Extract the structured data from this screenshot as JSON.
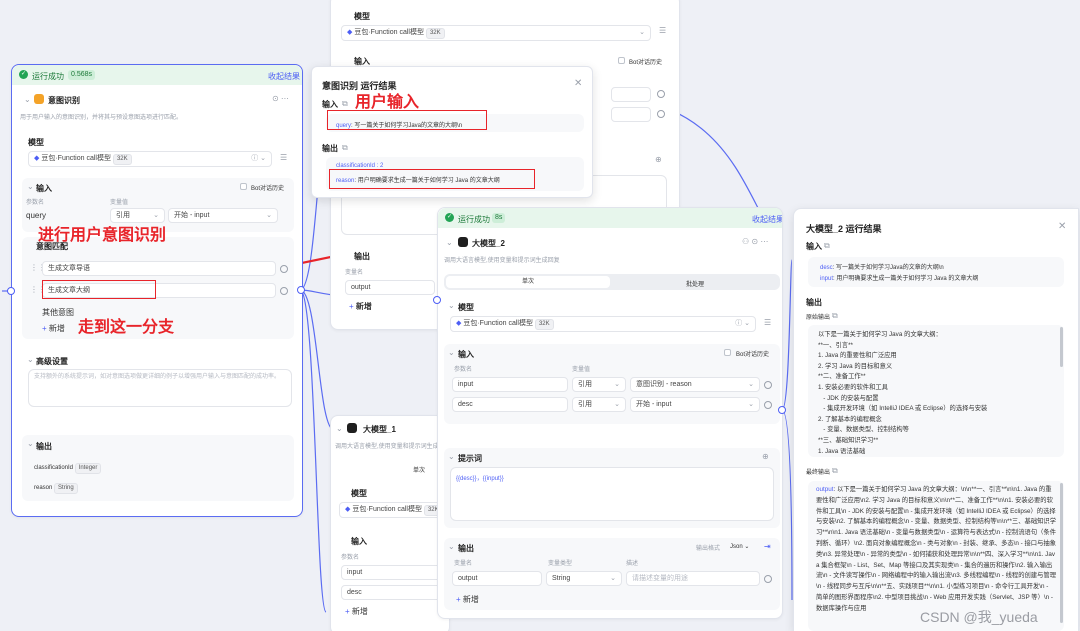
{
  "intent_node": {
    "status": "运行成功",
    "time": "0.568s",
    "collapse": "收起结果",
    "title": "意图识别",
    "desc": "用于用户输入的意图识别，并将其与预设意图选项进行匹配。",
    "model_label": "模型",
    "model_name": "豆包·Function call模型",
    "model_tag": "32K",
    "input_label": "输入",
    "bot_history": "Bot对话历史",
    "col_param": "参数名",
    "col_value": "变量值",
    "param_name": "query",
    "ref": "引用",
    "ref_value": "开始 - input",
    "intent_match": "意图匹配",
    "intent1": "生成文章导语",
    "intent2": "生成文章大纲",
    "other": "其他意图",
    "add": "新增",
    "advanced": "高级设置",
    "advanced_placeholder": "支持额外的系统提示词，如对意图选项做更详细的例子以增强用户输入与意图匹配的成功率。",
    "output_label": "输出",
    "out1_name": "classificationId",
    "out1_type": "Integer",
    "out2_name": "reason",
    "out2_type": "String"
  },
  "popup": {
    "title": "意图识别 运行结果",
    "input_label": "输入",
    "input_key": "query",
    "input_value": ": 写一篇关于如何学习Java的文章的大纲\\n",
    "output_label": "输出",
    "class_line": "classificationId : 2",
    "reason_key": "reason",
    "reason_value": ": 用户明确要求生成一篇关于如何学习 Java 的文章大纲"
  },
  "top_node": {
    "model_label": "模型",
    "model_name": "豆包·Function call模型",
    "model_tag": "32K",
    "input_label": "输入",
    "bot_history": "Bot对话历史",
    "output_label": "输出",
    "col_var": "变量名",
    "output_var": "output",
    "add": "新增"
  },
  "llm2": {
    "status": "运行成功",
    "time": "8s",
    "collapse": "收起结果",
    "title": "大模型_2",
    "desc": "调用大语言模型,使用变量和提示词生成回复",
    "tab_single": "单次",
    "tab_batch": "批处理",
    "model_label": "模型",
    "model_name": "豆包·Function call模型",
    "model_tag": "32K",
    "input_label": "输入",
    "bot_history": "Bot对话历史",
    "col_param": "参数名",
    "col_value": "变量值",
    "row1_name": "input",
    "row1_ref": "引用",
    "row1_value": "意图识别 - reason",
    "row2_name": "desc",
    "row2_ref": "引用",
    "row2_value": "开始 - input",
    "prompt_label": "提示词",
    "prompt_text": "{{desc}}，{{input}}",
    "output_label": "输出",
    "output_format_label": "输出格式",
    "output_format": "Json",
    "col_var": "变量名",
    "col_type": "变量类型",
    "col_desc": "描述",
    "output_var": "output",
    "output_type": "String",
    "output_desc_placeholder": "请描述变量的用途",
    "add": "新增"
  },
  "llm1": {
    "title": "大模型_1",
    "desc": "调用大语言模型,使用变量和提示词生成回复",
    "tab_single": "单次",
    "model_label": "模型",
    "model_name": "豆包·Function call模型",
    "model_tag": "32K",
    "input_label": "输入",
    "col_param": "参数名",
    "row1_name": "input",
    "row2_name": "desc",
    "add": "新增"
  },
  "result": {
    "title": "大模型_2 运行结果",
    "input_label": "输入",
    "in1_key": "desc",
    "in1_value": ": 写一篇关于如何学习Java的文章的大纲\\n",
    "in2_key": "input",
    "in2_value": ": 用户明确要求生成一篇关于如何学习 Java 的文章大纲",
    "output_label": "输出",
    "raw_label": "原始输出",
    "raw_text": "以下是一篇关于如何学习 Java 的文章大纲：\n**一、引言**\n1. Java 的重要性和广泛应用\n2. 学习 Java 的目标和意义\n**二、准备工作**\n1. 安装必要的软件和工具\n   - JDK 的安装与配置\n   - 集成开发环境（如 IntelliJ IDEA 或 Eclipse）的选择与安装\n2. 了解基本的编程概念\n   - 变量、数据类型、控制结构等\n**三、基础知识学习**\n1. Java 语法基础\n   - 变量与数据类型",
    "final_label": "最终输出",
    "final_key": "output",
    "final_text": ": 以下是一篇关于如何学习 Java 的文章大纲：\\n\\n**一、引言**\\n\\n1. Java 的重要性和广泛应用\\n2. 学习 Java 的目标和意义\\n\\n**二、准备工作**\\n\\n1. 安装必要的软件和工具\\n   - JDK 的安装与配置\\n   - 集成开发环境（如 IntelliJ IDEA 或 Eclipse）的选择与安装\\n2. 了解基本的编程概念\\n   - 变量、数据类型、控制结构等\\n\\n**三、基础知识学习**\\n\\n1. Java 语法基础\\n   - 变量与数据类型\\n   - 运算符与表达式\\n   - 控制流语句（条件判断、循环）\\n2. 面向对象编程概念\\n   - 类与对象\\n   - 封装、继承、多态\\n   - 接口与抽象类\\n3. 异常处理\\n   - 异常的类型\\n   - 如何捕获和处理异常\\n\\n**四、深入学习**\\n\\n1. Java 集合框架\\n   - List、Set、Map 等接口及其实现类\\n   - 集合的遍历和操作\\n2. 输入输出流\\n   - 文件读写操作\\n   - 网络编程中的输入输出流\\n3. 多线程编程\\n   - 线程的创建与管理\\n   - 线程同步与互斥\\n\\n**五、实践项目**\\n\\n1. 小型练习项目\\n   - 命令行工具开发\\n   - 简单的图形界面程序\\n2. 中型项目挑战\\n   - Web 应用开发实践（Servlet、JSP 等）\\n   - 数据库操作与应用"
  },
  "annotations": {
    "user_input": "用户输入",
    "intent_recog": "进行用户意图识别",
    "branch": "走到这一分支"
  },
  "watermark": "CSDN @我_yueda",
  "colors": {
    "accent": "#4d5ef5",
    "success": "#23a455",
    "annotation": "#e8242a"
  }
}
